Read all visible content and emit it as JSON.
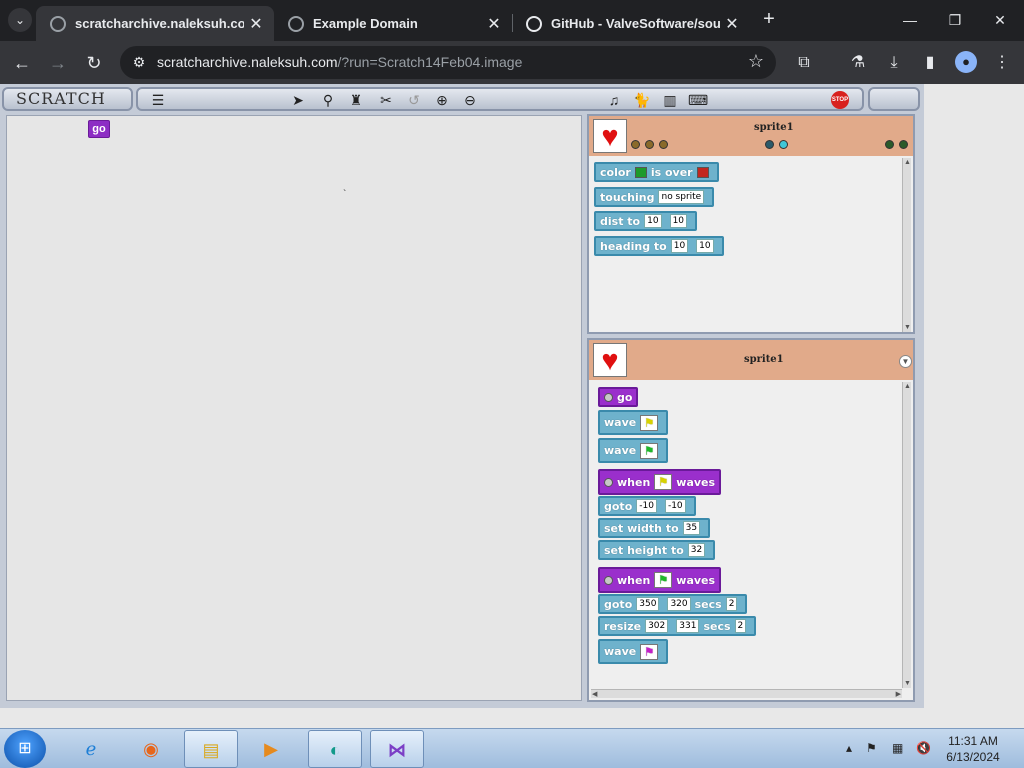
{
  "browser": {
    "tabs": [
      {
        "title": "scratcharchive.naleksuh.com/?",
        "active": true
      },
      {
        "title": "Example Domain",
        "active": false
      },
      {
        "title": "GitHub - ValveSoftware/source",
        "active": false
      }
    ],
    "url_host": "scratcharchive.naleksuh.com",
    "url_path": "/?run=Scratch14Feb04.image"
  },
  "scratch": {
    "logo": "SCRATCH",
    "stop_label": "STOP",
    "stage": {
      "go_label": "go",
      "mark": "`"
    },
    "sensing_panel": {
      "sprite_name": "sprite1",
      "blocks": {
        "color": "color",
        "is_over": "is over",
        "touching": "touching",
        "no_sprite": "no sprite",
        "dist_to": "dist to",
        "dist_x": "10",
        "dist_y": "10",
        "heading_to": "heading to",
        "heading_x": "10",
        "heading_y": "10"
      }
    },
    "script_panel": {
      "sprite_name": "sprite1",
      "go": "go",
      "wave": "wave",
      "when": "when",
      "waves": "waves",
      "goto": "goto",
      "goto_x1": "-10",
      "goto_y1": "-10",
      "set_width_to": "set width to",
      "width_val": "35",
      "set_height_to": "set height to",
      "height_val": "32",
      "goto_x2": "350",
      "goto_y2": "320",
      "secs": "secs",
      "secs_val1": "2",
      "resize": "resize",
      "resize_w": "302",
      "resize_h": "331",
      "secs_val2": "2"
    }
  },
  "taskbar": {
    "time": "11:31 AM",
    "date": "6/13/2024"
  }
}
